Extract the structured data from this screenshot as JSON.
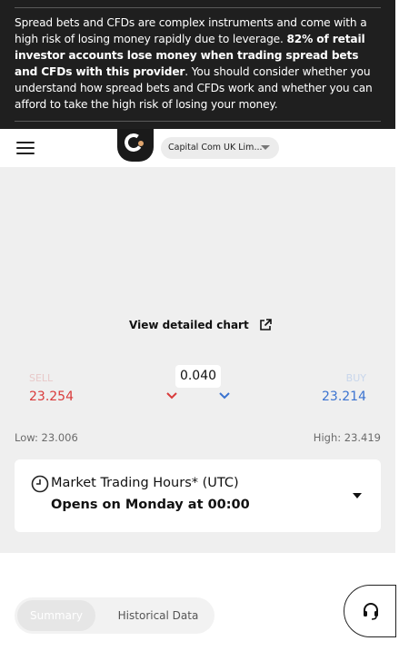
{
  "risk_warning": {
    "text_a": "Spread bets and CFDs are complex instruments and come with a high risk of losing money rapidly due to leverage. ",
    "text_bold": "82% of retail investor accounts lose money when trading spread bets and CFDs with this provider",
    "text_b": ". You should consider whether you understand how spread bets and CFDs work and whether you can afford to take the high risk of losing your money."
  },
  "header": {
    "menu_icon": "hamburger-menu-icon",
    "logo_icon": "capital-com-logo-icon",
    "entity_selector": "Capital Com UK Lim..."
  },
  "chart": {
    "detail_link": "View detailed chart",
    "link_icon": "external-link-icon"
  },
  "quote": {
    "sell_label": "SELL",
    "sell_price": "23.254",
    "spread": "0.040",
    "buy_label": "BUY",
    "buy_price": "23.214",
    "low": "Low: 23.006",
    "high": "High: 23.419"
  },
  "trading_hours": {
    "icon": "clock-icon",
    "title": "Market Trading Hours* (UTC)",
    "status": "Opens on Monday at 00:00"
  },
  "tabs": [
    {
      "label": "Summary",
      "active": true
    },
    {
      "label": "Historical Data",
      "active": false
    }
  ],
  "support": {
    "icon": "headset-support-icon"
  },
  "colors": {
    "banner_bg": "#1f1f1f",
    "sell": "#d93b3b",
    "buy": "#3b73d0",
    "panel_bg": "#efefef"
  }
}
